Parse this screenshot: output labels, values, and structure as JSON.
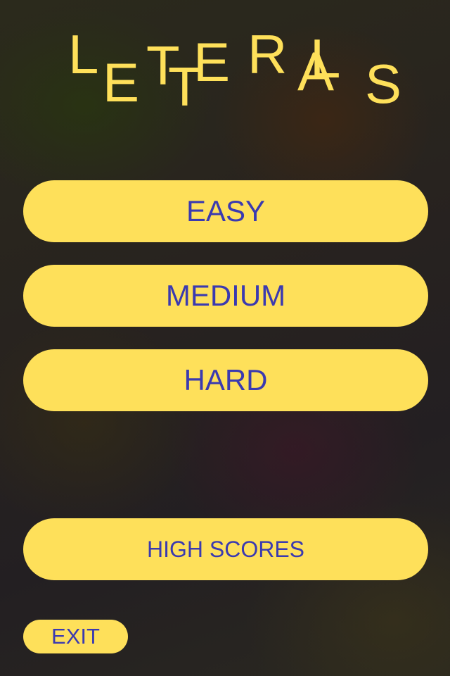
{
  "game": {
    "title_letters": [
      "L",
      "E",
      "T",
      "T",
      "E",
      "R",
      "L",
      "A",
      "S"
    ],
    "menu": {
      "easy": "EASY",
      "medium": "MEDIUM",
      "hard": "HARD",
      "high_scores": "HIGH SCORES",
      "exit": "EXIT"
    }
  },
  "colors": {
    "button_fill": "#fee05a",
    "button_text": "#3b3ab0",
    "title_letters": "#fee05a"
  }
}
